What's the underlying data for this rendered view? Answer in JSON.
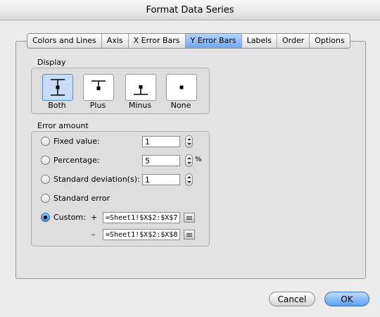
{
  "window": {
    "title": "Format Data Series"
  },
  "tabs": [
    {
      "label": "Colors and Lines",
      "active": false
    },
    {
      "label": "Axis",
      "active": false
    },
    {
      "label": "X Error Bars",
      "active": false
    },
    {
      "label": "Y Error Bars",
      "active": true
    },
    {
      "label": "Labels",
      "active": false
    },
    {
      "label": "Order",
      "active": false
    },
    {
      "label": "Options",
      "active": false
    }
  ],
  "display": {
    "label": "Display",
    "options": [
      {
        "label": "Both",
        "icon": "error-bar-both-icon",
        "selected": true
      },
      {
        "label": "Plus",
        "icon": "error-bar-plus-icon",
        "selected": false
      },
      {
        "label": "Minus",
        "icon": "error-bar-minus-icon",
        "selected": false
      },
      {
        "label": "None",
        "icon": "error-bar-none-icon",
        "selected": false
      }
    ]
  },
  "error_amount": {
    "label": "Error amount",
    "fixed_value": {
      "label": "Fixed value:",
      "value": "1",
      "checked": false
    },
    "percentage": {
      "label": "Percentage:",
      "value": "5",
      "unit": "%",
      "checked": false
    },
    "std_dev": {
      "label": "Standard deviation(s):",
      "value": "1",
      "checked": false
    },
    "std_error": {
      "label": "Standard error",
      "checked": false
    },
    "custom": {
      "label": "Custom:",
      "checked": true,
      "plus_sign": "+",
      "minus_sign": "–",
      "plus_value": "=Sheet1!$X$2:$X$7",
      "minus_value": "=Sheet1!$X$2:$X$8"
    }
  },
  "buttons": {
    "cancel": "Cancel",
    "ok": "OK"
  },
  "colors": {
    "selection_blue": "#6ea8ee",
    "accent": "#3a84df"
  }
}
